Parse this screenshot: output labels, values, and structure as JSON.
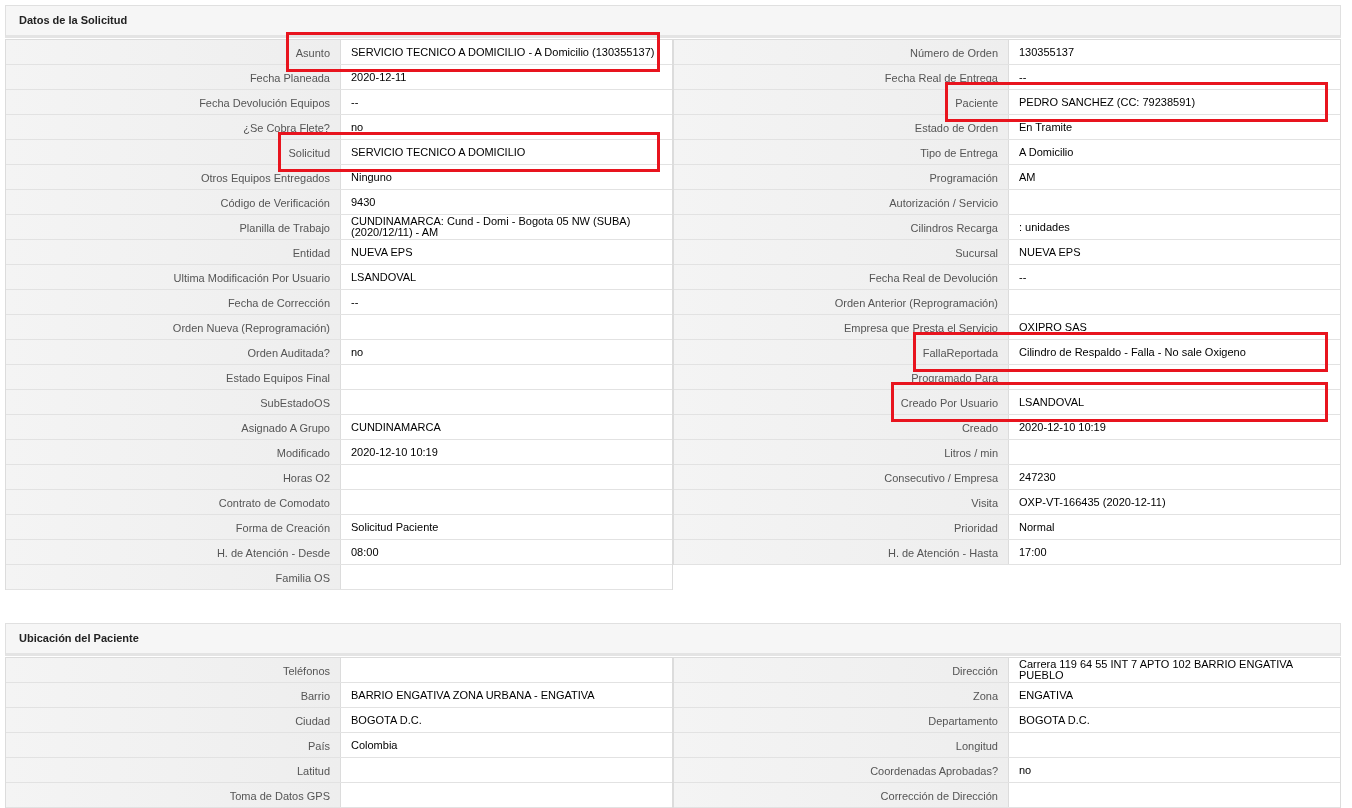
{
  "sections": [
    {
      "title": "Datos de la Solicitud",
      "left": [
        {
          "label": "Asunto",
          "value": "SERVICIO TECNICO A DOMICILIO - A Domicilio (130355137)",
          "highlighted": true
        },
        {
          "label": "Fecha Planeada",
          "value": "2020-12-11",
          "highlighted": false
        },
        {
          "label": "Fecha Devolución Equipos",
          "value": "--",
          "highlighted": false
        },
        {
          "label": "¿Se Cobra Flete?",
          "value": "no",
          "highlighted": false
        },
        {
          "label": "Solicitud",
          "value": "SERVICIO TECNICO A DOMICILIO",
          "highlighted": true
        },
        {
          "label": "Otros Equipos Entregados",
          "value": "Ninguno",
          "highlighted": false
        },
        {
          "label": "Código de Verificación",
          "value": "9430",
          "highlighted": false
        },
        {
          "label": "Planilla de Trabajo",
          "value": "CUNDINAMARCA: Cund - Domi - Bogota 05 NW (SUBA) (2020/12/11) - AM",
          "highlighted": false
        },
        {
          "label": "Entidad",
          "value": "NUEVA EPS",
          "highlighted": false
        },
        {
          "label": "Ultima Modificación Por Usuario",
          "value": "LSANDOVAL",
          "highlighted": false
        },
        {
          "label": "Fecha de Corrección",
          "value": "--",
          "highlighted": false
        },
        {
          "label": "Orden Nueva (Reprogramación)",
          "highlighted": false
        },
        {
          "label": "Orden Auditada?",
          "value": "no",
          "highlighted": false
        },
        {
          "label": "Estado Equipos Final",
          "highlighted": false
        },
        {
          "label": "SubEstadoOS",
          "highlighted": false
        },
        {
          "label": "Asignado A Grupo",
          "value": "CUNDINAMARCA",
          "highlighted": false
        },
        {
          "label": "Modificado",
          "value": "2020-12-10 10:19",
          "highlighted": false
        },
        {
          "label": "Horas O2",
          "highlighted": false
        },
        {
          "label": "Contrato de Comodato",
          "highlighted": false
        },
        {
          "label": "Forma de Creación",
          "value": "Solicitud Paciente",
          "highlighted": false
        },
        {
          "label": "H. de Atención - Desde",
          "value": "08:00",
          "highlighted": false
        },
        {
          "label": "Familia OS",
          "highlighted": false
        }
      ],
      "right": [
        {
          "label": "Número de Orden",
          "value": "130355137",
          "highlighted": false
        },
        {
          "label": "Fecha Real de Entrega",
          "value": "--",
          "highlighted": false
        },
        {
          "label": "Paciente",
          "value": "PEDRO SANCHEZ (CC: 79238591)",
          "highlighted": true
        },
        {
          "label": "Estado de Orden",
          "value": "En Tramite",
          "highlighted": false
        },
        {
          "label": "Tipo de Entrega",
          "value": "A Domicilio",
          "highlighted": false
        },
        {
          "label": "Programación",
          "value": "AM",
          "highlighted": false
        },
        {
          "label": "Autorización / Servicio",
          "highlighted": false
        },
        {
          "label": "Cilindros Recarga",
          "value": ": unidades",
          "highlighted": false
        },
        {
          "label": "Sucursal",
          "value": "NUEVA EPS",
          "highlighted": false
        },
        {
          "label": "Fecha Real de Devolución",
          "value": "--",
          "highlighted": false
        },
        {
          "label": "Orden Anterior (Reprogramación)",
          "highlighted": false
        },
        {
          "label": "Empresa que Presta el Servicio",
          "value": "OXIPRO SAS",
          "highlighted": false
        },
        {
          "label": "FallaReportada",
          "value": "Cilindro de Respaldo - Falla - No sale Oxigeno",
          "highlighted": true
        },
        {
          "label": "Programado Para",
          "highlighted": false
        },
        {
          "label": "Creado Por Usuario",
          "value": "LSANDOVAL",
          "highlighted": true
        },
        {
          "label": "Creado",
          "value": "2020-12-10 10:19",
          "highlighted": false
        },
        {
          "label": "Litros / min",
          "highlighted": false
        },
        {
          "label": "Consecutivo / Empresa",
          "value": "247230",
          "highlighted": false
        },
        {
          "label": "Visita",
          "value": "OXP-VT-166435 (2020-12-11)",
          "highlighted": false
        },
        {
          "label": "Prioridad",
          "value": "Normal",
          "highlighted": false
        },
        {
          "label": "H. de Atención - Hasta",
          "value": "17:00",
          "highlighted": false
        }
      ]
    },
    {
      "title": "Ubicación del Paciente",
      "left": [
        {
          "label": "Teléfonos",
          "highlighted": false
        },
        {
          "label": "Barrio",
          "value": "BARRIO ENGATIVA ZONA URBANA - ENGATIVA",
          "highlighted": false
        },
        {
          "label": "Ciudad",
          "value": "BOGOTA D.C.",
          "highlighted": false
        },
        {
          "label": "País",
          "value": "Colombia",
          "highlighted": false
        },
        {
          "label": "Latitud",
          "highlighted": false
        },
        {
          "label": "Toma de Datos GPS",
          "highlighted": false
        }
      ],
      "right": [
        {
          "label": "Dirección",
          "value": "Carrera 119 64 55 INT 7 APTO 102 BARRIO ENGATIVA PUEBLO",
          "highlighted": false
        },
        {
          "label": "Zona",
          "value": "ENGATIVA",
          "highlighted": false
        },
        {
          "label": "Departamento",
          "value": "BOGOTA D.C.",
          "highlighted": false
        },
        {
          "label": "Longitud",
          "highlighted": false
        },
        {
          "label": "Coordenadas Aprobadas?",
          "value": "no",
          "highlighted": false
        },
        {
          "label": "Corrección de Dirección",
          "highlighted": false
        }
      ]
    }
  ]
}
